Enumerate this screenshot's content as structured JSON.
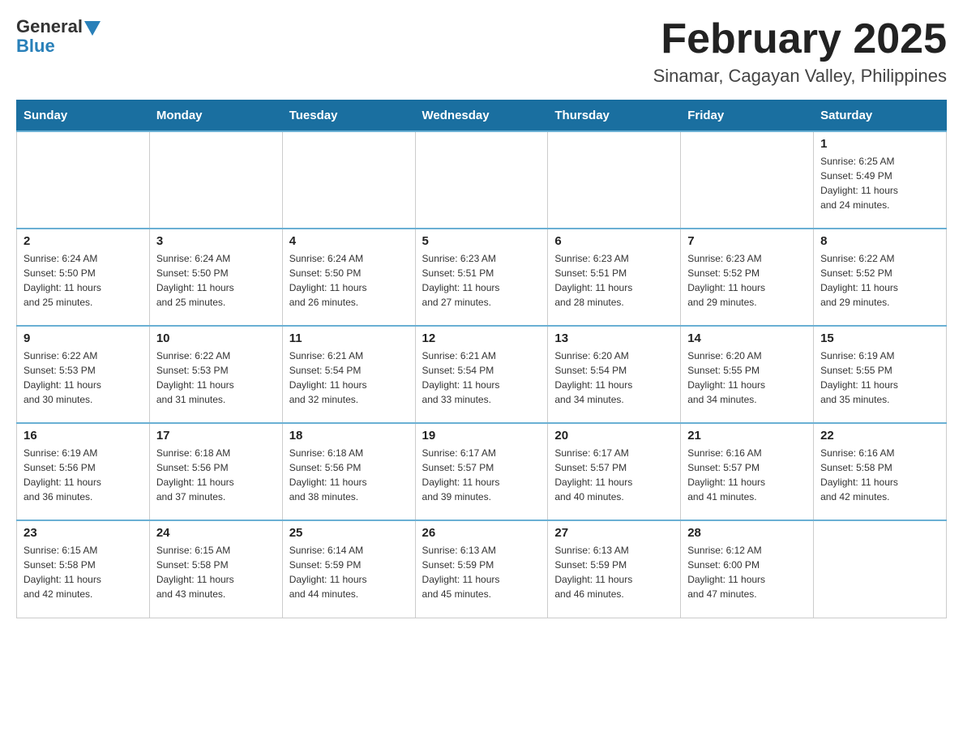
{
  "header": {
    "logo_general": "General",
    "logo_blue": "Blue",
    "month_title": "February 2025",
    "location": "Sinamar, Cagayan Valley, Philippines"
  },
  "weekdays": [
    "Sunday",
    "Monday",
    "Tuesday",
    "Wednesday",
    "Thursday",
    "Friday",
    "Saturday"
  ],
  "weeks": [
    [
      {
        "day": "",
        "info": ""
      },
      {
        "day": "",
        "info": ""
      },
      {
        "day": "",
        "info": ""
      },
      {
        "day": "",
        "info": ""
      },
      {
        "day": "",
        "info": ""
      },
      {
        "day": "",
        "info": ""
      },
      {
        "day": "1",
        "info": "Sunrise: 6:25 AM\nSunset: 5:49 PM\nDaylight: 11 hours\nand 24 minutes."
      }
    ],
    [
      {
        "day": "2",
        "info": "Sunrise: 6:24 AM\nSunset: 5:50 PM\nDaylight: 11 hours\nand 25 minutes."
      },
      {
        "day": "3",
        "info": "Sunrise: 6:24 AM\nSunset: 5:50 PM\nDaylight: 11 hours\nand 25 minutes."
      },
      {
        "day": "4",
        "info": "Sunrise: 6:24 AM\nSunset: 5:50 PM\nDaylight: 11 hours\nand 26 minutes."
      },
      {
        "day": "5",
        "info": "Sunrise: 6:23 AM\nSunset: 5:51 PM\nDaylight: 11 hours\nand 27 minutes."
      },
      {
        "day": "6",
        "info": "Sunrise: 6:23 AM\nSunset: 5:51 PM\nDaylight: 11 hours\nand 28 minutes."
      },
      {
        "day": "7",
        "info": "Sunrise: 6:23 AM\nSunset: 5:52 PM\nDaylight: 11 hours\nand 29 minutes."
      },
      {
        "day": "8",
        "info": "Sunrise: 6:22 AM\nSunset: 5:52 PM\nDaylight: 11 hours\nand 29 minutes."
      }
    ],
    [
      {
        "day": "9",
        "info": "Sunrise: 6:22 AM\nSunset: 5:53 PM\nDaylight: 11 hours\nand 30 minutes."
      },
      {
        "day": "10",
        "info": "Sunrise: 6:22 AM\nSunset: 5:53 PM\nDaylight: 11 hours\nand 31 minutes."
      },
      {
        "day": "11",
        "info": "Sunrise: 6:21 AM\nSunset: 5:54 PM\nDaylight: 11 hours\nand 32 minutes."
      },
      {
        "day": "12",
        "info": "Sunrise: 6:21 AM\nSunset: 5:54 PM\nDaylight: 11 hours\nand 33 minutes."
      },
      {
        "day": "13",
        "info": "Sunrise: 6:20 AM\nSunset: 5:54 PM\nDaylight: 11 hours\nand 34 minutes."
      },
      {
        "day": "14",
        "info": "Sunrise: 6:20 AM\nSunset: 5:55 PM\nDaylight: 11 hours\nand 34 minutes."
      },
      {
        "day": "15",
        "info": "Sunrise: 6:19 AM\nSunset: 5:55 PM\nDaylight: 11 hours\nand 35 minutes."
      }
    ],
    [
      {
        "day": "16",
        "info": "Sunrise: 6:19 AM\nSunset: 5:56 PM\nDaylight: 11 hours\nand 36 minutes."
      },
      {
        "day": "17",
        "info": "Sunrise: 6:18 AM\nSunset: 5:56 PM\nDaylight: 11 hours\nand 37 minutes."
      },
      {
        "day": "18",
        "info": "Sunrise: 6:18 AM\nSunset: 5:56 PM\nDaylight: 11 hours\nand 38 minutes."
      },
      {
        "day": "19",
        "info": "Sunrise: 6:17 AM\nSunset: 5:57 PM\nDaylight: 11 hours\nand 39 minutes."
      },
      {
        "day": "20",
        "info": "Sunrise: 6:17 AM\nSunset: 5:57 PM\nDaylight: 11 hours\nand 40 minutes."
      },
      {
        "day": "21",
        "info": "Sunrise: 6:16 AM\nSunset: 5:57 PM\nDaylight: 11 hours\nand 41 minutes."
      },
      {
        "day": "22",
        "info": "Sunrise: 6:16 AM\nSunset: 5:58 PM\nDaylight: 11 hours\nand 42 minutes."
      }
    ],
    [
      {
        "day": "23",
        "info": "Sunrise: 6:15 AM\nSunset: 5:58 PM\nDaylight: 11 hours\nand 42 minutes."
      },
      {
        "day": "24",
        "info": "Sunrise: 6:15 AM\nSunset: 5:58 PM\nDaylight: 11 hours\nand 43 minutes."
      },
      {
        "day": "25",
        "info": "Sunrise: 6:14 AM\nSunset: 5:59 PM\nDaylight: 11 hours\nand 44 minutes."
      },
      {
        "day": "26",
        "info": "Sunrise: 6:13 AM\nSunset: 5:59 PM\nDaylight: 11 hours\nand 45 minutes."
      },
      {
        "day": "27",
        "info": "Sunrise: 6:13 AM\nSunset: 5:59 PM\nDaylight: 11 hours\nand 46 minutes."
      },
      {
        "day": "28",
        "info": "Sunrise: 6:12 AM\nSunset: 6:00 PM\nDaylight: 11 hours\nand 47 minutes."
      },
      {
        "day": "",
        "info": ""
      }
    ]
  ]
}
